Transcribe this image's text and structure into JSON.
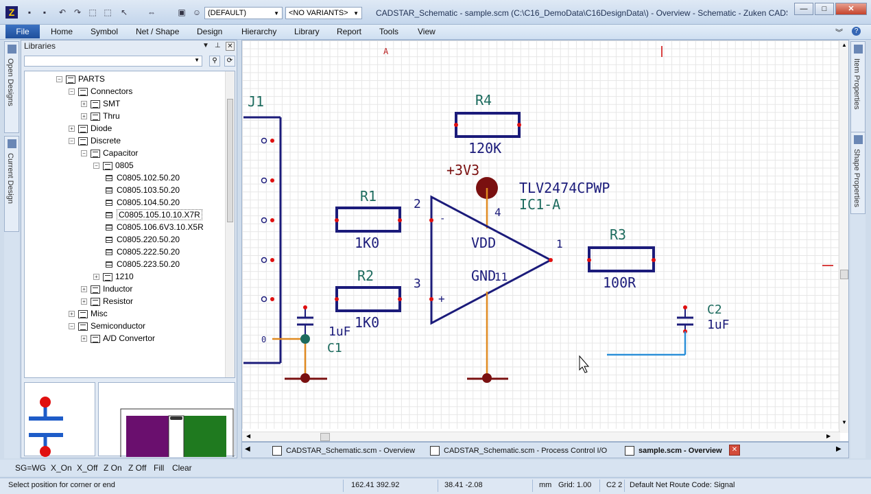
{
  "window": {
    "title": "CADSTAR_Schematic - sample.scm (C:\\C16_DemoData\\C16DesignData\\) - Overview - Schematic - Zuken CADS...",
    "variant_combo": "(DEFAULT)",
    "variants_combo": "<NO VARIANTS>"
  },
  "ribbon": {
    "file": "File",
    "tabs": [
      "Home",
      "Symbol",
      "Net / Shape",
      "Design",
      "Hierarchy",
      "Library",
      "Report",
      "Tools",
      "View"
    ]
  },
  "left_tabs": [
    "Open Designs",
    "Current Design"
  ],
  "right_tabs": [
    "Item Properties",
    "Shape Properties"
  ],
  "libraries": {
    "title": "Libraries",
    "tree": [
      {
        "label": "PARTS",
        "toggle": "⊟",
        "kind": "folder"
      },
      {
        "label": "Connectors",
        "toggle": "⊟",
        "kind": "folder"
      },
      {
        "label": "SMT",
        "toggle": "⊞",
        "kind": "folder"
      },
      {
        "label": "Thru",
        "toggle": "⊞",
        "kind": "folder"
      },
      {
        "label": "Diode",
        "toggle": "⊞",
        "kind": "folder"
      },
      {
        "label": "Discrete",
        "toggle": "⊟",
        "kind": "folder"
      },
      {
        "label": "Capacitor",
        "toggle": "⊟",
        "kind": "folder"
      },
      {
        "label": "0805",
        "toggle": "⊟",
        "kind": "folder"
      },
      {
        "label": "C0805.102.50.20",
        "kind": "part"
      },
      {
        "label": "C0805.103.50.20",
        "kind": "part"
      },
      {
        "label": "C0805.104.50.20",
        "kind": "part"
      },
      {
        "label": "C0805.105.10.10.X7R",
        "kind": "part",
        "selected": true
      },
      {
        "label": "C0805.106.6V3.10.X5R",
        "kind": "part"
      },
      {
        "label": "C0805.220.50.20",
        "kind": "part"
      },
      {
        "label": "C0805.222.50.20",
        "kind": "part"
      },
      {
        "label": "C0805.223.50.20",
        "kind": "part"
      },
      {
        "label": "1210",
        "toggle": "⊞",
        "kind": "folder"
      },
      {
        "label": "Inductor",
        "toggle": "⊞",
        "kind": "folder"
      },
      {
        "label": "Resistor",
        "toggle": "⊞",
        "kind": "folder"
      },
      {
        "label": "Misc",
        "toggle": "⊞",
        "kind": "folder"
      },
      {
        "label": "Semiconductor",
        "toggle": "⊟",
        "kind": "folder"
      },
      {
        "label": "A/D Convertor",
        "toggle": "⊞",
        "kind": "folder"
      }
    ]
  },
  "schematic": {
    "zone_label": "A",
    "J1": "J1",
    "R4": {
      "ref": "R4",
      "value": "120K"
    },
    "R1": {
      "ref": "R1",
      "value": "1K0"
    },
    "R2": {
      "ref": "R2",
      "value": "1K0"
    },
    "R3": {
      "ref": "R3",
      "value": "100R"
    },
    "power": "+3V3",
    "ic_part": "TLV2474CPWP",
    "ic_ref": "IC1-A",
    "vdd": "VDD",
    "gnd": "GND",
    "pin2": "2",
    "pin3": "3",
    "pin4": "4",
    "pin1": "1",
    "pin11": "11",
    "minus": "-",
    "plus": "+",
    "C1": {
      "ref": "C1",
      "value": "1uF"
    },
    "C2": {
      "ref": "C2",
      "value": "1uF"
    },
    "j1_pin0": "0"
  },
  "doc_tabs": [
    "CADSTAR_Schematic.scm - Overview",
    "CADSTAR_Schematic.scm - Process Control I/O",
    "sample.scm - Overview"
  ],
  "filter_buttons": [
    "SG=WG",
    "X_On",
    "X_Off",
    "Z On",
    "Z Off",
    "Fill",
    "Clear"
  ],
  "status": {
    "prompt": "Select position for corner or end",
    "coords": "162.41  392.92",
    "delta": "38.41  -2.08",
    "units": "mm",
    "grid": "Grid: 1.00",
    "cell": "C2 2",
    "route": "Default Net Route Code: Signal"
  },
  "colors": {
    "component": "#1b1b7a",
    "label": "#1d6b5e",
    "wire": "#e08a20",
    "power": "#7a1010",
    "pin": "#e01010"
  }
}
